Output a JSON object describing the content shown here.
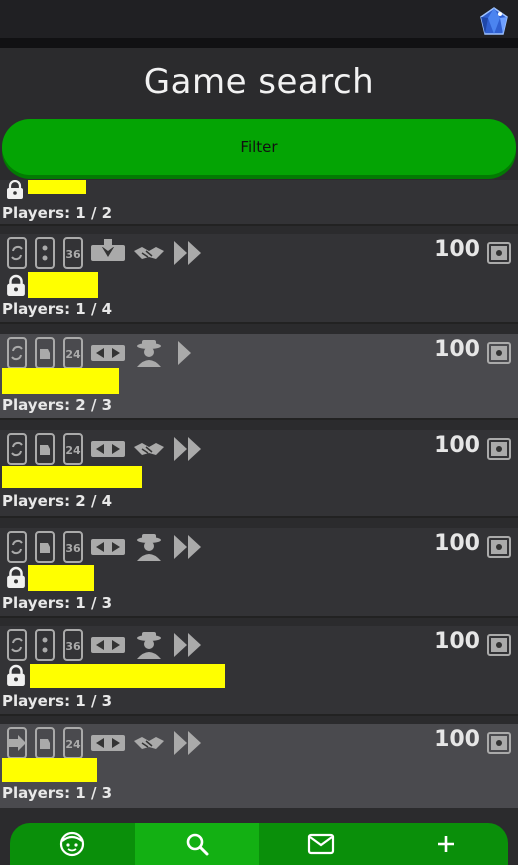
{
  "header": {
    "title": "Game search"
  },
  "filter": {
    "label": "Filter"
  },
  "games": [
    {
      "players": "Players: 1 / 2",
      "stake": "",
      "locked": true,
      "deck": "",
      "theme": "dark",
      "partial": true
    },
    {
      "players": "Players: 1 / 4",
      "stake": "100",
      "locked": true,
      "deck": "",
      "theme": "dark"
    },
    {
      "players": "Players: 2 / 3",
      "stake": "100",
      "locked": false,
      "deck": "24",
      "theme": "light"
    },
    {
      "players": "Players: 2 / 4",
      "stake": "100",
      "locked": false,
      "deck": "24",
      "theme": "dark"
    },
    {
      "players": "Players: 1 / 3",
      "stake": "100",
      "locked": true,
      "deck": "36",
      "theme": "dark"
    },
    {
      "players": "Players: 1 / 3",
      "stake": "100",
      "locked": true,
      "deck": "36",
      "theme": "dark"
    },
    {
      "players": "Players: 1 / 3",
      "stake": "100",
      "locked": false,
      "deck": "24",
      "theme": "light"
    }
  ],
  "deck_labels": [
    "36",
    "24",
    "24",
    "36",
    "36",
    "24"
  ],
  "nav": [
    "face-icon",
    "search-icon",
    "mail-icon",
    "plus-icon"
  ],
  "colors": {
    "accent": "#04a404",
    "name_highlight": "#ffff00",
    "background": "#2b2b2d"
  }
}
